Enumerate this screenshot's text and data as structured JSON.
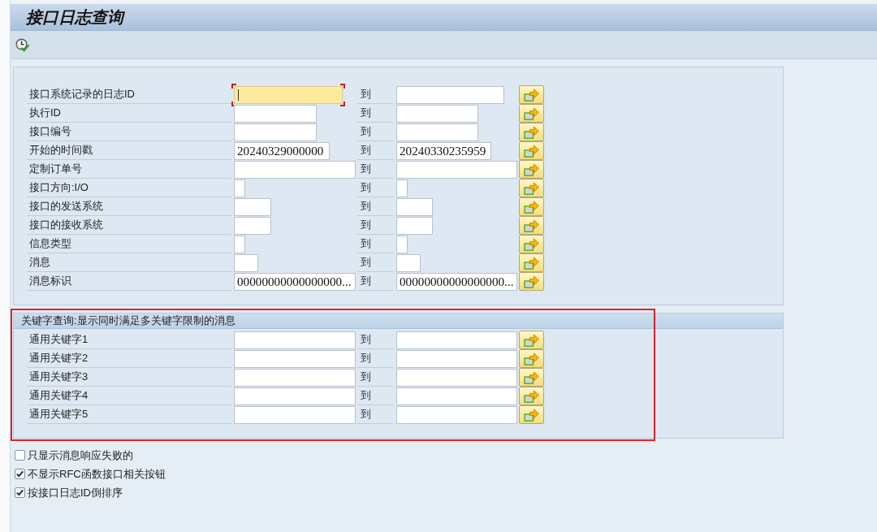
{
  "window": {
    "title": "接口日志查询"
  },
  "selection": {
    "rows": [
      {
        "label": "接口系统记录的日志ID",
        "focused": true,
        "to_label": "到"
      },
      {
        "label": "执行ID",
        "focused": false,
        "to_label": "到"
      },
      {
        "label": "接口编号",
        "focused": false,
        "to_label": "到"
      },
      {
        "label": "开始的时间戳",
        "focused": false,
        "from_value": "20240329000000",
        "to_label": "到",
        "to_value": "20240330235959"
      },
      {
        "label": "定制订单号",
        "focused": false,
        "to_label": "到"
      },
      {
        "label": "接口方向:I/O",
        "focused": false,
        "to_label": "到"
      },
      {
        "label": "接口的发送系统",
        "focused": false,
        "to_label": "到"
      },
      {
        "label": "接口的接收系统",
        "focused": false,
        "to_label": "到"
      },
      {
        "label": "信息类型",
        "focused": false,
        "to_label": "到"
      },
      {
        "label": "消息",
        "focused": false,
        "to_label": "到"
      },
      {
        "label": "消息标识",
        "focused": false,
        "from_value": "00000000000000000...",
        "to_label": "到",
        "to_value": "00000000000000000..."
      }
    ]
  },
  "keyword_section": {
    "title": "关键字查询:显示同时满足多关键字限制的消息",
    "rows": [
      {
        "label": "通用关键字1",
        "focused": false,
        "to_label": "到"
      },
      {
        "label": "通用关键字2",
        "focused": false,
        "to_label": "到"
      },
      {
        "label": "通用关键字3",
        "focused": false,
        "to_label": "到"
      },
      {
        "label": "通用关键字4",
        "focused": false,
        "to_label": "到"
      },
      {
        "label": "通用关键字5",
        "focused": false,
        "to_label": "到"
      }
    ]
  },
  "options": [
    {
      "label": "只显示消息响应失败的",
      "checked": false
    },
    {
      "label": "不显示RFC函数接口相关按钮",
      "checked": true
    },
    {
      "label": "按接口日志ID倒排序",
      "checked": true
    }
  ]
}
